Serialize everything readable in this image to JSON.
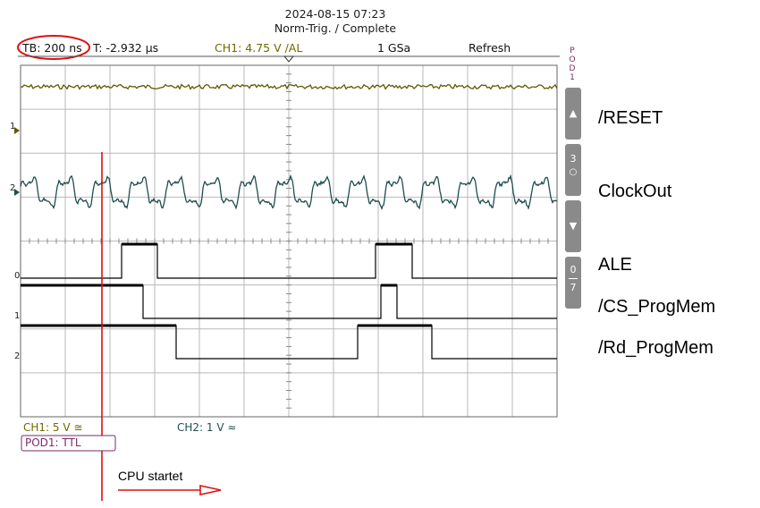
{
  "header": {
    "datetime": "2024-08-15 07:23",
    "trigger_status": "Norm-Trig. / Complete"
  },
  "status_bar": {
    "timebase": "TB: 200 ns",
    "trigger_time": "T: -2.932 µs",
    "ch1_trigger": "CH1: 4.75 V ∕AL",
    "sample_rate": "1 GSa",
    "mode": "Refresh"
  },
  "channel_markers": {
    "ch1": "1",
    "ch2": "2",
    "d0": "0",
    "d1": "1",
    "d2": "2"
  },
  "side_panel": {
    "pod_tag": [
      "P",
      "O",
      "D",
      "1"
    ],
    "up_glyph": "▲",
    "knob_number": "3",
    "down_glyph": "▼",
    "range_top": "0",
    "range_bottom": "7"
  },
  "signal_labels": [
    "/RESET",
    "ClockOut",
    "ALE",
    "/CS_ProgMem",
    "/Rd_ProgMem"
  ],
  "footer": {
    "ch1_scale": "CH1: 5 V ≅",
    "ch2_scale": "CH2: 1 V ≈",
    "pod1_label": "POD1: TTL"
  },
  "annotation": {
    "text": "CPU startet"
  },
  "colors": {
    "ch1_trace": "#5e5a00",
    "ch2_trace": "#1f4d4d",
    "digital_trace": "#000000",
    "grid": "#b9b9b9",
    "annotation_red": "#dd1111",
    "pod_border": "#7a2a6a",
    "side_button": "#8a8a8a"
  }
}
